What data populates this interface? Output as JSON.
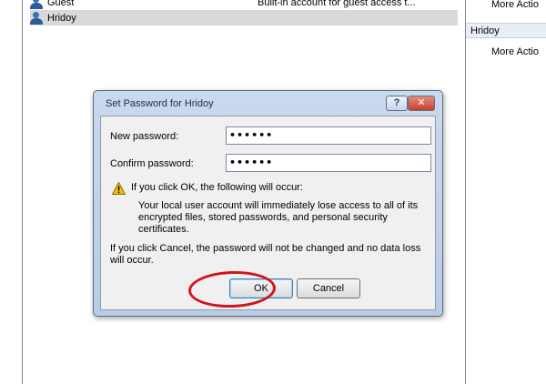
{
  "user_list": {
    "rows": [
      {
        "name": "Guest",
        "description": "Built-in account for guest access t..."
      },
      {
        "name": "Hridoy",
        "description": ""
      }
    ]
  },
  "actions": {
    "more_actions_1": "More Actio",
    "section_hridoy": "Hridoy",
    "more_actions_2": "More Actio"
  },
  "dialog": {
    "title": "Set Password for Hridoy",
    "help_label": "?",
    "close_label": "✕",
    "new_password_label": "New password:",
    "new_password_value": "••••••",
    "confirm_password_label": "Confirm password:",
    "confirm_password_value": "••••••",
    "warning_heading": "If you click OK, the following will occur:",
    "consequence": "Your local user account will immediately lose access to all of its encrypted files, stored passwords, and personal security certificates.",
    "cancel_note": "If you click Cancel, the password will not be changed and no data loss will occur.",
    "ok_label": "OK",
    "cancel_label": "Cancel"
  },
  "colors": {
    "highlight_ring": "#d0161b",
    "warning_icon": "#f2c200",
    "close_button": "#c8412c"
  },
  "icons": {
    "user": "user-icon",
    "warning": "warning-icon",
    "help": "help-icon",
    "close": "close-icon"
  }
}
